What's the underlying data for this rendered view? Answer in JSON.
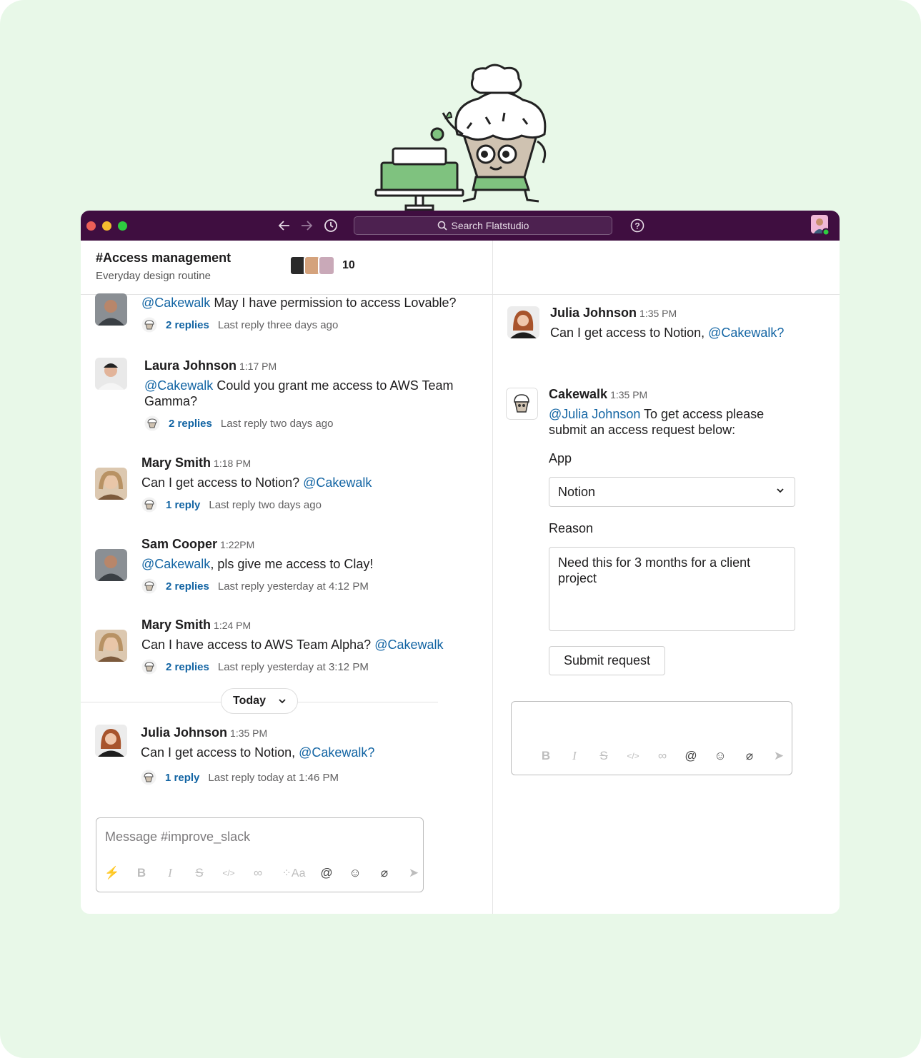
{
  "search": {
    "placeholder": "Search Flatstudio"
  },
  "channel": {
    "name": "#Access management",
    "topic": "Everyday design routine",
    "member_count": "10"
  },
  "messages": [
    {
      "author": "",
      "time": "",
      "mention": "@Cakewalk",
      "text": " May I have permission to access Lovable?",
      "mention_first": true,
      "replies": "2 replies",
      "last_reply": "Last reply three days ago"
    },
    {
      "author": "Laura Johnson",
      "time": "1:17 PM",
      "mention": "@Cakewalk",
      "text": " Could you grant me access to AWS Team Gamma?",
      "mention_first": true,
      "replies": "2 replies",
      "last_reply": "Last reply two days ago"
    },
    {
      "author": "Mary Smith",
      "time": "1:18 PM",
      "mention": "@Cakewalk",
      "text": "Can I get access to Notion? ",
      "mention_first": false,
      "replies": "1 reply",
      "last_reply": "Last reply two days ago"
    },
    {
      "author": "Sam Cooper",
      "time": "1:22PM",
      "mention": "@Cakewalk",
      "text": ", pls give me access to Clay!",
      "mention_first": true,
      "replies": "2 replies",
      "last_reply": "Last reply yesterday at 4:12 PM"
    },
    {
      "author": "Mary Smith",
      "time": "1:24 PM",
      "mention": "@Cakewalk",
      "text": "Can I have access to AWS Team Alpha? ",
      "mention_first": false,
      "replies": "2 replies",
      "last_reply": "Last reply yesterday at 3:12 PM"
    },
    {
      "author": "Julia Johnson",
      "time": "1:35 PM",
      "mention": "@Cakewalk?",
      "text": "Can I get access to Notion, ",
      "mention_first": false,
      "replies": "1 reply",
      "last_reply": "Last reply today at 1:46 PM"
    }
  ],
  "divider": {
    "label": "Today"
  },
  "composer": {
    "placeholder": "Message #improve_slack"
  },
  "thread": {
    "parent": {
      "author": "Julia Johnson",
      "time": "1:35 PM",
      "text": "Can I get access to Notion, ",
      "mention": "@Cakewalk?"
    },
    "bot": {
      "author": "Cakewalk",
      "time": "1:35 PM",
      "mention": "@Julia Johnson",
      "text": " To get access please submit an access request below:"
    },
    "form": {
      "app_label": "App",
      "app_value": "Notion",
      "reason_label": "Reason",
      "reason_value": "Need this for 3 months for a client project",
      "submit_label": "Submit request"
    }
  },
  "colors": {
    "titlebar": "#3f0e40",
    "mention": "#1264a3",
    "background": "#e8f8e8"
  }
}
